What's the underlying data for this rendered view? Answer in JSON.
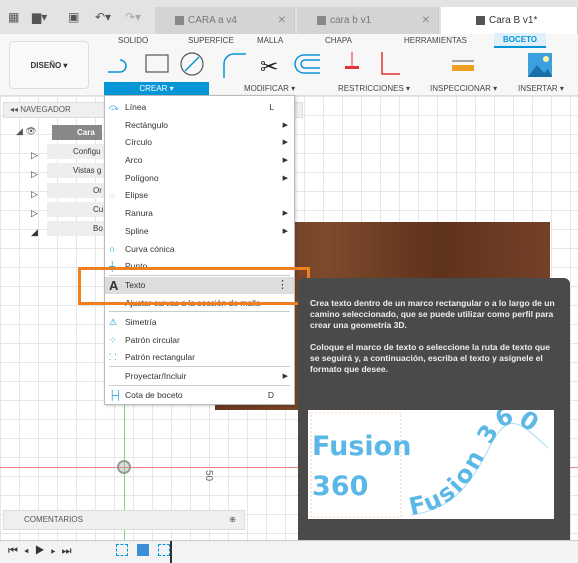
{
  "tabs": [
    {
      "label": "CARA  a v4"
    },
    {
      "label": "cara b v1"
    },
    {
      "label": "Cara B v1*"
    }
  ],
  "workspace": "DISEÑO ▾",
  "toolbar_tabs": [
    "SOLIDO",
    "SUPERFICE",
    "MALLA",
    "CHAPA",
    "HERRAMIENTAS",
    "BOCETO"
  ],
  "groups": [
    "CREAR ▾",
    "MODIFICAR ▾",
    "RESTRICCIONES ▾",
    "INSPECCIONAR ▾",
    "INSERTAR ▾"
  ],
  "navigator": {
    "title": "NAVEGADOR",
    "items": [
      "Cara B",
      "Configu",
      "Vistas g",
      "Or",
      "Cu",
      "Bo"
    ]
  },
  "menu": [
    {
      "label": "Línea",
      "shortcut": "L",
      "icon": "line-icon"
    },
    {
      "label": "Rectángulo",
      "sub": true
    },
    {
      "label": "Círculo",
      "sub": true
    },
    {
      "label": "Arco",
      "sub": true
    },
    {
      "label": "Polígono",
      "sub": true
    },
    {
      "label": "Elipse",
      "icon": "ellipse-icon"
    },
    {
      "label": "Ranura",
      "sub": true
    },
    {
      "label": "Spline",
      "sub": true
    },
    {
      "label": "Curva cónica",
      "icon": "conic-curve-icon"
    },
    {
      "label": "Punto",
      "icon": "point-icon"
    },
    {
      "label": "Texto",
      "icon": "text-icon",
      "highlighted": true
    },
    {
      "label": "Ajustar curvas a la sección de malla",
      "icon": "fit-curve-icon"
    },
    {
      "label": "Simetría",
      "icon": "mirror-icon"
    },
    {
      "label": "Patrón circular",
      "icon": "circular-pattern-icon"
    },
    {
      "label": "Patrón rectangular",
      "icon": "rectangular-pattern-icon"
    },
    {
      "label": "Proyectar/Incluir",
      "sub": true
    },
    {
      "label": "Cota de boceto",
      "shortcut": "D",
      "icon": "dimension-icon"
    }
  ],
  "tooltip": {
    "p1": "Crea texto dentro de un marco rectangular o a lo largo de un camino seleccionado, que se puede utilizar como perfil para crear una geometría 3D.",
    "p2": "Coloque el marco de texto o seleccione la ruta de texto que se seguirá y, a continuación, escriba el texto y asígnele el formato que desee.",
    "img_line1": "Fusion",
    "img_line2": "360",
    "img_path": "Fusion 360"
  },
  "axis_label": "50",
  "comments": "COMENTARIOS",
  "colors": {
    "accent": "#0696d7",
    "highlight": "#f07f21",
    "tooltip_bg": "#4a4a4a"
  }
}
